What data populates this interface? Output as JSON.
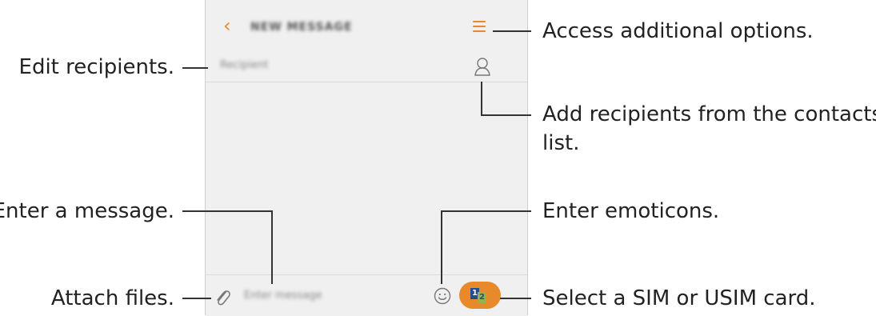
{
  "phone": {
    "title": "NEW MESSAGE",
    "recipient_placeholder": "Recipient",
    "message_placeholder": "Enter message",
    "sim_primary": "1",
    "sim_secondary": "2",
    "accent": "#e8892b"
  },
  "callouts": {
    "additional_options": "Access additional options.",
    "edit_recipients": "Edit recipients.",
    "add_from_contacts_line1": "Add recipients from the contacts",
    "add_from_contacts_line2": "list.",
    "enter_message": "Enter a message.",
    "enter_emoticons": "Enter emoticons.",
    "attach_files": "Attach files.",
    "select_sim": "Select a SIM or USIM card."
  },
  "icons": [
    "back-icon",
    "menu-icon",
    "contact-icon",
    "paperclip-icon",
    "emoticon-icon",
    "sim-card-icon"
  ]
}
